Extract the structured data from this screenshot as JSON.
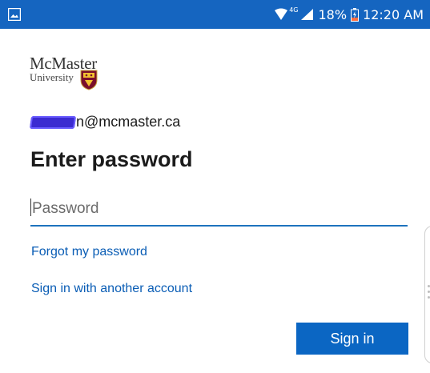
{
  "status_bar": {
    "network_label": "4G",
    "battery": "18%",
    "time": "12:20 AM",
    "icons": [
      "image-icon",
      "wifi-icon",
      "signal-icon",
      "battery-icon"
    ]
  },
  "logo": {
    "line1": "McMaster",
    "line2": "University",
    "icon": "crest-icon"
  },
  "account": {
    "email_visible_part": "n@mcmaster.ca"
  },
  "title": "Enter password",
  "password_field": {
    "placeholder": "Password",
    "value": ""
  },
  "links": {
    "forgot": "Forgot my password",
    "other_account": "Sign in with another account"
  },
  "sign_in_button": {
    "label": "Sign in"
  },
  "colors": {
    "status_bar": "#1565c0",
    "accent": "#0b66c3",
    "link": "#0a5db5",
    "input_underline": "#1e73be"
  }
}
